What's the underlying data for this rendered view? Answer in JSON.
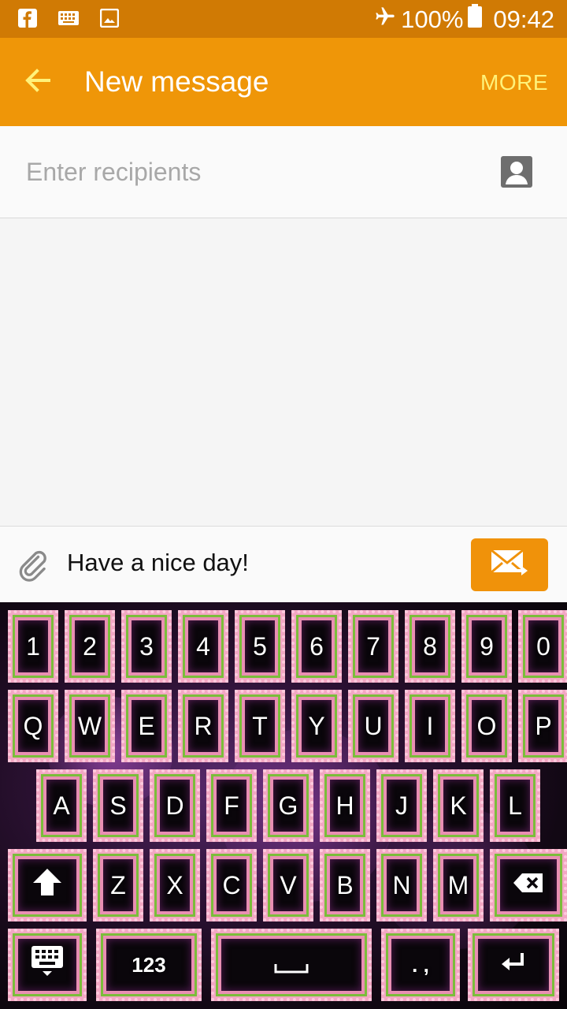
{
  "status_bar": {
    "icons_left": [
      "facebook-icon",
      "keyboard-icon",
      "image-icon"
    ],
    "airplane_icon": "airplane-icon",
    "battery_text": "100%",
    "battery_icon": "battery-icon",
    "time": "09:42"
  },
  "app_bar": {
    "back_icon": "back-arrow-icon",
    "title": "New message",
    "more_label": "MORE"
  },
  "recipients": {
    "placeholder": "Enter recipients",
    "value": "",
    "contact_icon": "contact-icon"
  },
  "composer": {
    "attach_icon": "paperclip-icon",
    "message": "Have a nice day!",
    "send_icon": "send-message-icon"
  },
  "keyboard": {
    "row_numbers": [
      "1",
      "2",
      "3",
      "4",
      "5",
      "6",
      "7",
      "8",
      "9",
      "0"
    ],
    "row_1": [
      "Q",
      "W",
      "E",
      "R",
      "T",
      "Y",
      "U",
      "I",
      "O",
      "P"
    ],
    "row_2": [
      "A",
      "S",
      "D",
      "F",
      "G",
      "H",
      "J",
      "K",
      "L"
    ],
    "row_3": [
      "Z",
      "X",
      "C",
      "V",
      "B",
      "N",
      "M"
    ],
    "shift_icon": "shift-icon",
    "backspace_icon": "backspace-icon",
    "keyboard_switch_icon": "keyboard-switch-icon",
    "numbers_label": "123",
    "space_icon": "space-bar-icon",
    "punct_label": ". ,",
    "enter_icon": "enter-icon"
  },
  "colors": {
    "status_bar": "#d07a04",
    "app_bar": "#ef9608",
    "more_text": "#fff27a",
    "send_button": "#f0920a",
    "key_border_pink": "#f2a7c3",
    "key_leaf_green": "#7bbd3a"
  }
}
